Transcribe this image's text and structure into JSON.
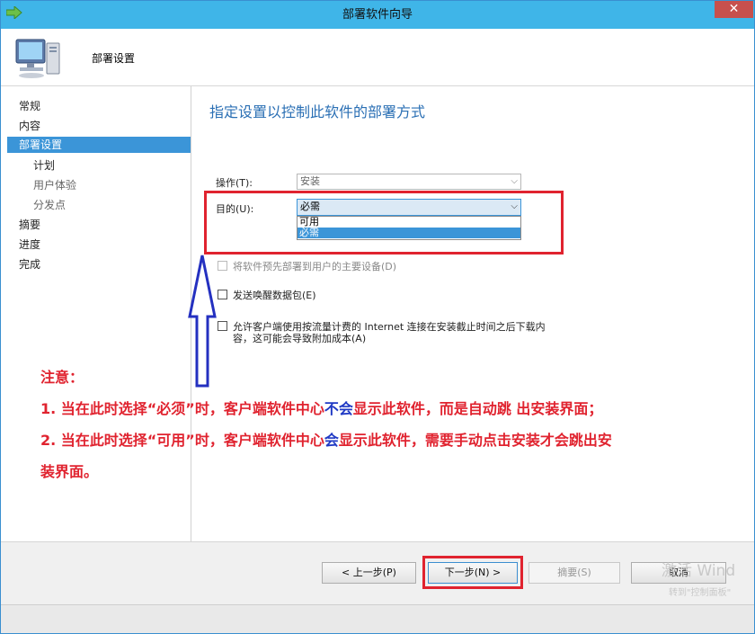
{
  "window": {
    "title": "部署软件向导",
    "close_label": "✕"
  },
  "header": {
    "title": "部署设置"
  },
  "sidebar": {
    "items": [
      {
        "label": "常规"
      },
      {
        "label": "内容"
      },
      {
        "label": "部署设置"
      },
      {
        "label": "计划"
      },
      {
        "label": "用户体验"
      },
      {
        "label": "分发点"
      },
      {
        "label": "摘要"
      },
      {
        "label": "进度"
      },
      {
        "label": "完成"
      }
    ]
  },
  "main": {
    "title": "指定设置以控制此软件的部署方式",
    "action_label": "操作(T):",
    "action_value": "安装",
    "purpose_label": "目的(U):",
    "purpose_value": "必需",
    "purpose_options": [
      "可用",
      "必需"
    ],
    "checkbox_predeploy": "将软件预先部署到用户的主要设备(D)",
    "checkbox_wake": "发送唤醒数据包(E)",
    "checkbox_metered_line1": "允许客户端使用按流量计费的 Internet 连接在安装截止时间之后下载内",
    "checkbox_metered_line2": "容，这可能会导致附加成本(A)"
  },
  "annotation": {
    "heading": "注意：",
    "line1_a": "1. 当在此时选择“必须”时，客户端软件中心",
    "line1_b": "不会",
    "line1_c": "显示此软件，而是自动跳 出安装界面；",
    "line2_a": "2. 当在此时选择“可用”时，客户端软件中心",
    "line2_b": "会",
    "line2_c": "显示此软件，需要手动点击安装才会跳出安",
    "line3": "装界面。"
  },
  "footer": {
    "prev_label": "< 上一步(P)",
    "next_label": "下一步(N) >",
    "summary_label": "摘要(S)",
    "cancel_label": "取消"
  },
  "watermark": {
    "text": "激活 Wind",
    "sub": "转到\"控制面板\""
  },
  "colors": {
    "accent": "#3b95d8",
    "title_bar": "#3fb5e8",
    "annotation_red": "#e0232f",
    "annotation_blue": "#1f39c4"
  }
}
